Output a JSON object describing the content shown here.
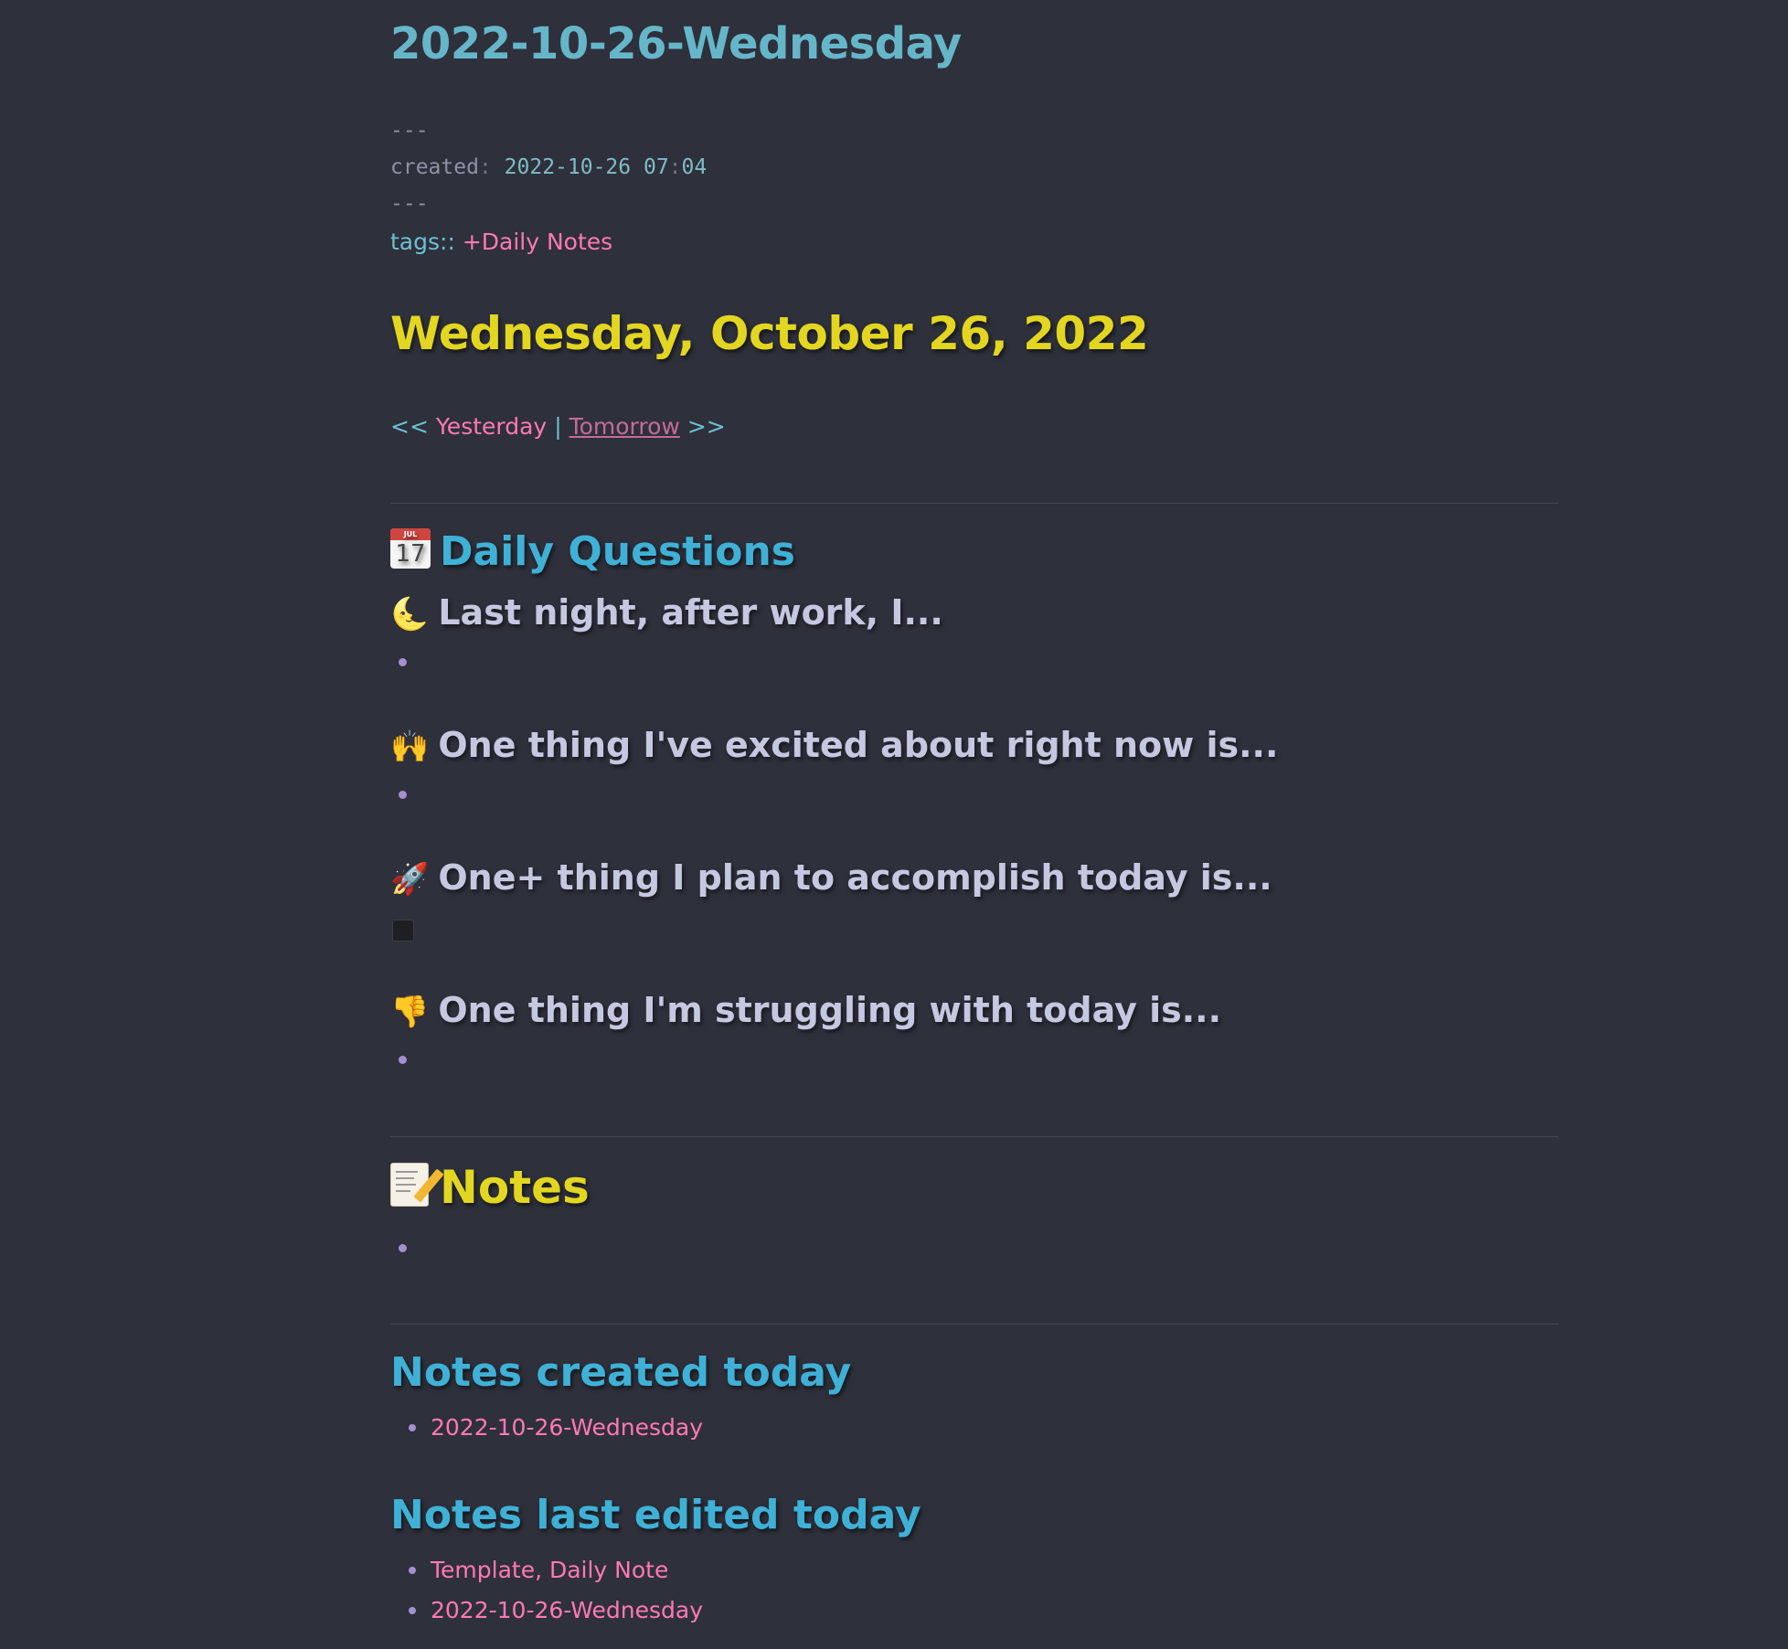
{
  "note": {
    "title": "2022-10-26-Wednesday"
  },
  "frontmatter": {
    "dashes_open": "---",
    "created_key": "created",
    "created_colon": ":",
    "created_date": "2022-10-26 07",
    "created_colon2": ":",
    "created_min": "04",
    "dashes_close": "---"
  },
  "tags": {
    "key": "tags::",
    "value": "+Daily Notes"
  },
  "date_heading": "Wednesday, October 26, 2022",
  "nav": {
    "left_arrows": "<<",
    "yesterday": "Yesterday",
    "separator": "|",
    "tomorrow": "Tomorrow",
    "right_arrows": ">>"
  },
  "daily_questions": {
    "icon": "calendar-icon",
    "calendar_month": "JUL",
    "calendar_day": "17",
    "title": "Daily Questions",
    "questions": [
      {
        "emoji": "🌜",
        "icon": "crescent-moon-icon",
        "text": "Last night, after work, I..."
      },
      {
        "emoji": "🙌",
        "icon": "raised-hands-icon",
        "text": "One thing I've excited about right now is..."
      },
      {
        "emoji": "🚀",
        "icon": "rocket-icon",
        "text": "One+ thing I plan to accomplish today is..."
      },
      {
        "emoji": "👎",
        "icon": "thumbs-down-icon",
        "text": "One thing I'm struggling with today is..."
      }
    ]
  },
  "notes_section": {
    "icon": "memo-icon",
    "title": "Notes"
  },
  "created_today": {
    "title": "Notes created today",
    "items": [
      "2022-10-26-Wednesday"
    ]
  },
  "edited_today": {
    "title": "Notes last edited today",
    "items": [
      "Template, Daily Note",
      "2022-10-26-Wednesday"
    ]
  },
  "colors": {
    "background": "#2e303b",
    "title_cyan": "#66b6c9",
    "heading_cyan": "#3fb1d7",
    "heading_yellow": "#e3d620",
    "link_pink": "#ff79b4",
    "bullet_purple": "#a58fd0"
  }
}
